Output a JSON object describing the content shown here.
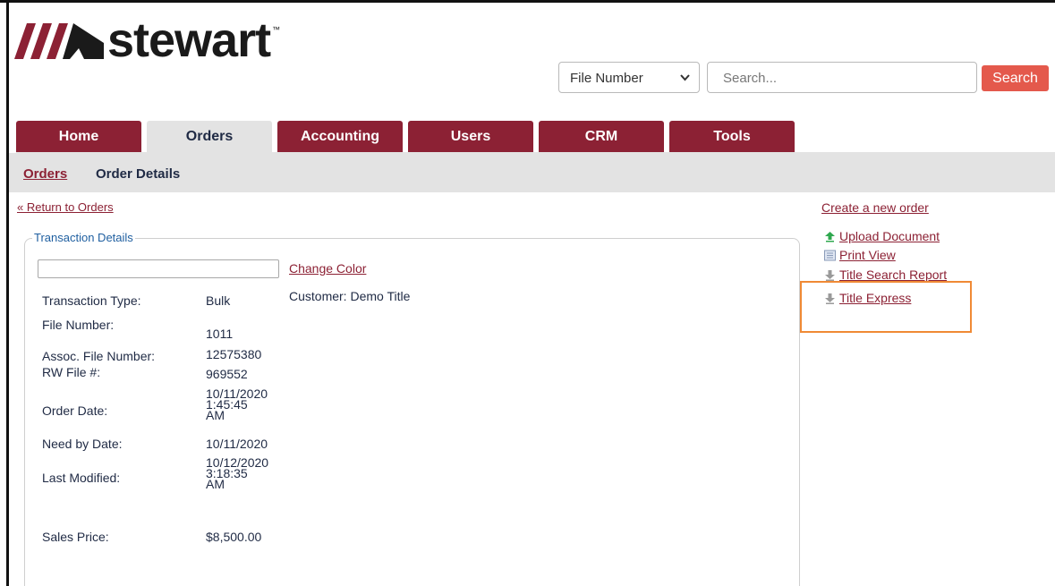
{
  "brand": {
    "name": "stewart",
    "tm": "™"
  },
  "search": {
    "type_selected": "File Number",
    "placeholder": "Search...",
    "button_label": "Search"
  },
  "tabs": [
    "Home",
    "Orders",
    "Accounting",
    "Users",
    "CRM",
    "Tools"
  ],
  "active_tab": "Orders",
  "subnav": {
    "link": "Orders",
    "current": "Order Details"
  },
  "return_link": "« Return to Orders",
  "transaction": {
    "legend": "Transaction Details",
    "change_color": "Change Color",
    "customer": "Customer: Demo Title",
    "fields": {
      "transaction_type": {
        "label": "Transaction Type:",
        "value": "Bulk"
      },
      "file_number": {
        "label": "File Number:",
        "value": "1011"
      },
      "assoc_file_number": {
        "label": "Assoc. File Number:",
        "value": "12575380"
      },
      "rw_file": {
        "label": "RW File #:",
        "value": "969552"
      },
      "order_date": {
        "label": "Order Date:",
        "value": [
          "10/11/2020",
          "1:45:45",
          "AM"
        ]
      },
      "need_by_date": {
        "label": "Need by Date:",
        "value": "10/11/2020"
      },
      "last_modified": {
        "label": "Last Modified:",
        "value": [
          "10/12/2020",
          "3:18:35",
          "AM"
        ]
      },
      "sales_price": {
        "label": "Sales Price:",
        "value": "$8,500.00"
      }
    }
  },
  "right_panel": {
    "create_order": "Create a new order",
    "actions": [
      {
        "label": "Upload Document",
        "icon": "upload-arrow-icon"
      },
      {
        "label": "Print View",
        "icon": "print-view-icon"
      },
      {
        "label": "Title Search Report",
        "icon": "download-arrow-icon"
      },
      {
        "label": "Title Express",
        "icon": "download-arrow-icon"
      }
    ]
  },
  "colors": {
    "brand_maroon": "#8c2134",
    "search_button": "#e4594c",
    "highlight": "#f08a35",
    "tab_inactive_bg": "#e3e3e3"
  }
}
